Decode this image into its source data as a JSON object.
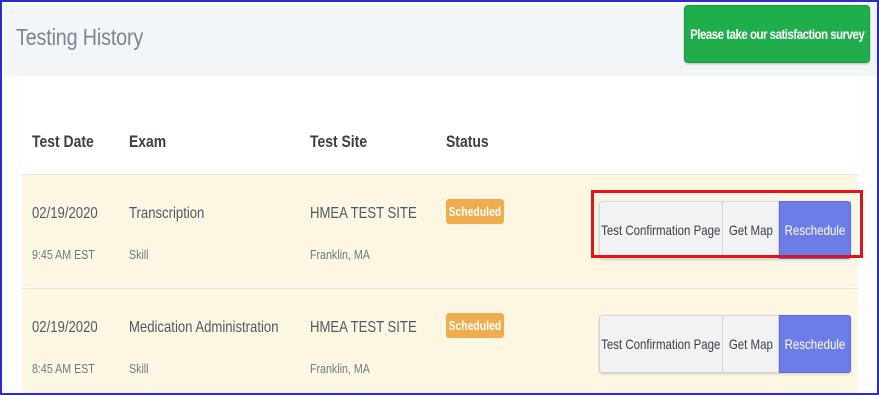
{
  "header": {
    "title": "Testing History",
    "survey_button": "Please take our satisfaction survey"
  },
  "table": {
    "columns": [
      "Test Date",
      "Exam",
      "Test Site",
      "Status"
    ],
    "rows": [
      {
        "date": "02/19/2020",
        "time": "9:45 AM EST",
        "exam": "Transcription",
        "exam_type": "Skill",
        "site": "HMEA TEST SITE",
        "location": "Franklin, MA",
        "status": "Scheduled",
        "actions": {
          "confirmation": "Test Confirmation Page",
          "map": "Get Map",
          "reschedule": "Reschedule"
        }
      },
      {
        "date": "02/19/2020",
        "time": "8:45 AM EST",
        "exam": "Medication Administration",
        "exam_type": "Skill",
        "site": "HMEA TEST SITE",
        "location": "Franklin, MA",
        "status": "Scheduled",
        "actions": {
          "confirmation": "Test Confirmation Page",
          "map": "Get Map",
          "reschedule": "Reschedule"
        }
      }
    ]
  },
  "colors": {
    "survey_green": "#1fae4b",
    "status_orange": "#f0ad4e",
    "reschedule_blue": "#6c7de8",
    "highlight_red": "#e0141b",
    "row_background": "#fdf6e2"
  }
}
